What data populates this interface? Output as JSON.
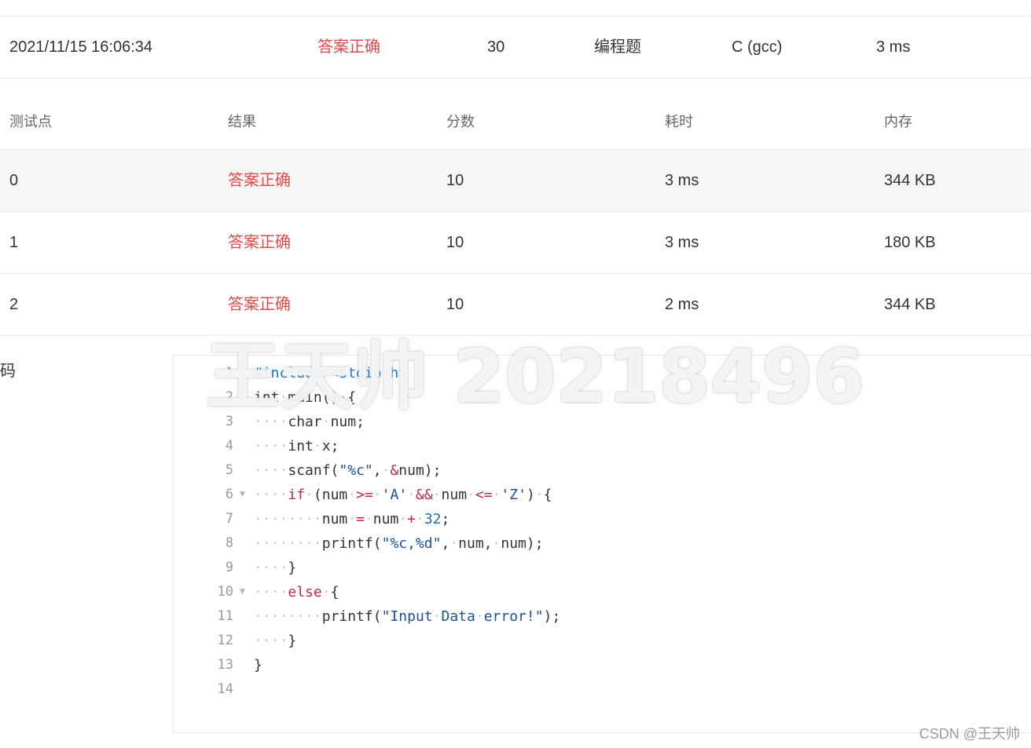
{
  "summary": {
    "submit_time": "2021/11/15 16:06:34",
    "status": "答案正确",
    "score": "30",
    "problem_type": "编程题",
    "compiler": "C (gcc)",
    "time": "3 ms"
  },
  "testpoints": {
    "headers": [
      "测试点",
      "结果",
      "分数",
      "耗时",
      "内存"
    ],
    "rows": [
      {
        "id": "0",
        "result": "答案正确",
        "score": "10",
        "time": "3 ms",
        "memory": "344 KB"
      },
      {
        "id": "1",
        "result": "答案正确",
        "score": "10",
        "time": "3 ms",
        "memory": "180 KB"
      },
      {
        "id": "2",
        "result": "答案正确",
        "score": "10",
        "time": "2 ms",
        "memory": "344 KB"
      }
    ]
  },
  "code_section": {
    "label": "代码",
    "lines": [
      {
        "n": "1",
        "fold": "",
        "text": "#include <stdio.h>"
      },
      {
        "n": "2",
        "fold": "▼",
        "text": "int main() {"
      },
      {
        "n": "3",
        "fold": "",
        "text": "    char num;"
      },
      {
        "n": "4",
        "fold": "",
        "text": "    int x;"
      },
      {
        "n": "5",
        "fold": "",
        "text": "    scanf(\"%c\", &num);"
      },
      {
        "n": "6",
        "fold": "▼",
        "text": "    if (num >= 'A' && num <= 'Z') {"
      },
      {
        "n": "7",
        "fold": "",
        "text": "        num = num + 32;"
      },
      {
        "n": "8",
        "fold": "",
        "text": "        printf(\"%c,%d\", num, num);"
      },
      {
        "n": "9",
        "fold": "",
        "text": "    }"
      },
      {
        "n": "10",
        "fold": "▼",
        "text": "    else {"
      },
      {
        "n": "11",
        "fold": "",
        "text": "        printf(\"Input Data error!\");"
      },
      {
        "n": "12",
        "fold": "",
        "text": "    }"
      },
      {
        "n": "13",
        "fold": "",
        "text": "}"
      },
      {
        "n": "14",
        "fold": "",
        "text": ""
      }
    ]
  },
  "watermark": "王天帅 20218496",
  "csdn_mark": "CSDN @王天帅",
  "colors": {
    "accepted": "#e04a4a",
    "keyword": "#c7254e",
    "string": "#1e4f9a"
  }
}
